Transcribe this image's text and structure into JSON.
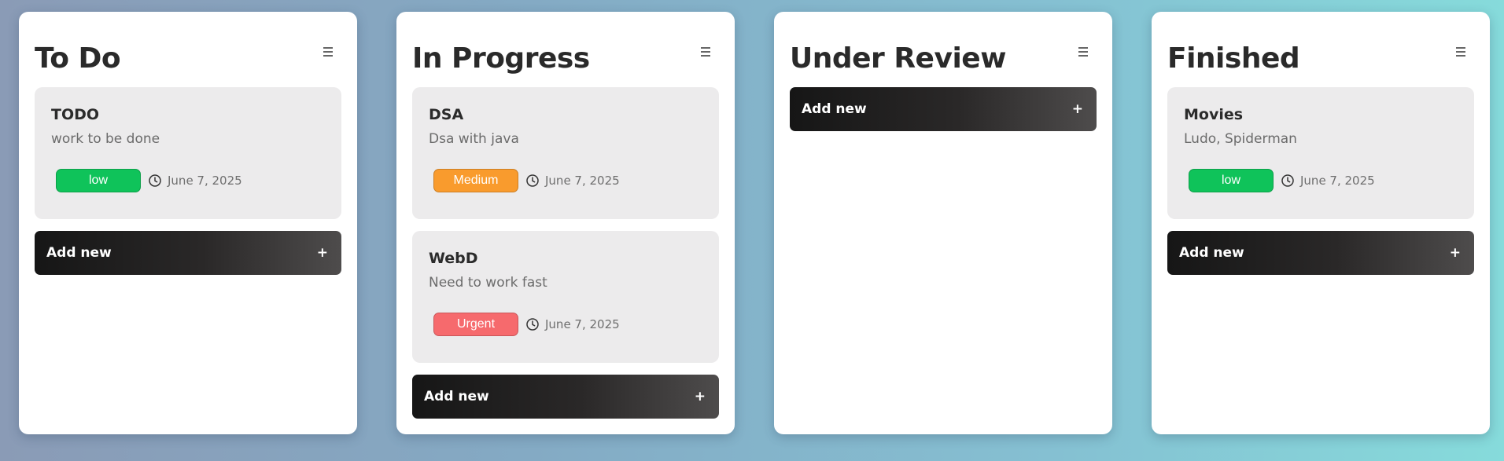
{
  "colors": {
    "low": "#0fc35a",
    "medium": "#f99b2d",
    "urgent": "#f66a6d"
  },
  "columns": [
    {
      "title": "To Do",
      "menu_icon": "hamburger-menu-icon",
      "cards": [
        {
          "title": "TODO",
          "description": "work to be done",
          "priority": "low",
          "date": "June 7, 2025"
        }
      ],
      "add_label": "Add new",
      "add_icon": "+"
    },
    {
      "title": "In Progress",
      "menu_icon": "hamburger-menu-icon",
      "cards": [
        {
          "title": "DSA",
          "description": "Dsa with java",
          "priority": "Medium",
          "date": "June 7, 2025"
        },
        {
          "title": "WebD",
          "description": "Need to work fast",
          "priority": "Urgent",
          "date": "June 7, 2025"
        }
      ],
      "add_label": "Add new",
      "add_icon": "+"
    },
    {
      "title": "Under Review",
      "menu_icon": "hamburger-menu-icon",
      "cards": [],
      "add_label": "Add new",
      "add_icon": "+"
    },
    {
      "title": "Finished",
      "menu_icon": "hamburger-menu-icon",
      "cards": [
        {
          "title": "Movies",
          "description": "Ludo, Spiderman",
          "priority": "low",
          "date": "June 7, 2025"
        }
      ],
      "add_label": "Add new",
      "add_icon": "+"
    }
  ]
}
